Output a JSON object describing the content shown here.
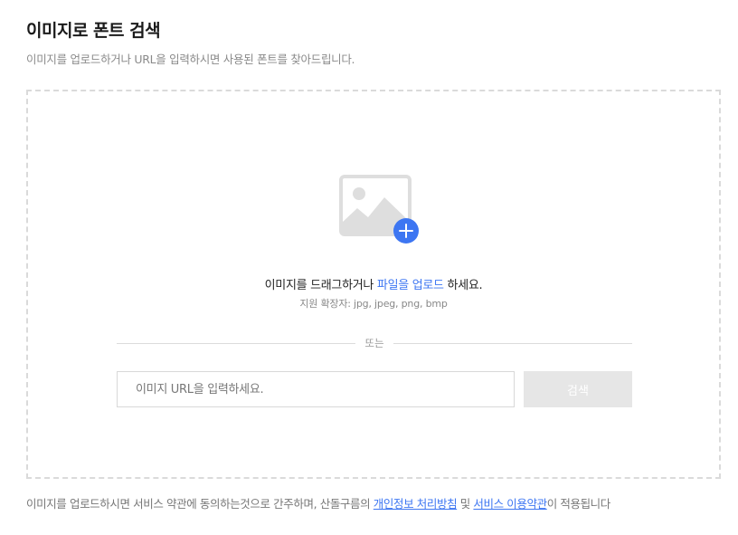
{
  "header": {
    "title": "이미지로 폰트 검색",
    "subtitle": "이미지를 업로드하거나 URL을 입력하시면 사용된 폰트를 찾아드립니다."
  },
  "dropzone": {
    "drag_prefix": "이미지를 드래그하거나 ",
    "upload_link": "파일을 업로드",
    "drag_suffix": " 하세요.",
    "supported_ext": "지원 확장자: jpg, jpeg, png, bmp",
    "divider_text": "또는",
    "url_placeholder": "이미지 URL을 입력하세요.",
    "search_label": "검색"
  },
  "footer": {
    "prefix": "이미지를 업로드하시면 서비스 약관에 동의하는것으로 간주하며, 산돌구름의 ",
    "privacy_link": "개인정보 처리방침",
    "and_text": " 및 ",
    "terms_link": "서비스 이용약관",
    "suffix": "이 적용됩니다"
  },
  "colors": {
    "accent": "#3d76f2",
    "icon_gray": "#dedede",
    "button_disabled": "#e6e6e6"
  },
  "icons": {
    "image_placeholder": "image-upload-icon",
    "plus": "plus-circle-icon"
  }
}
